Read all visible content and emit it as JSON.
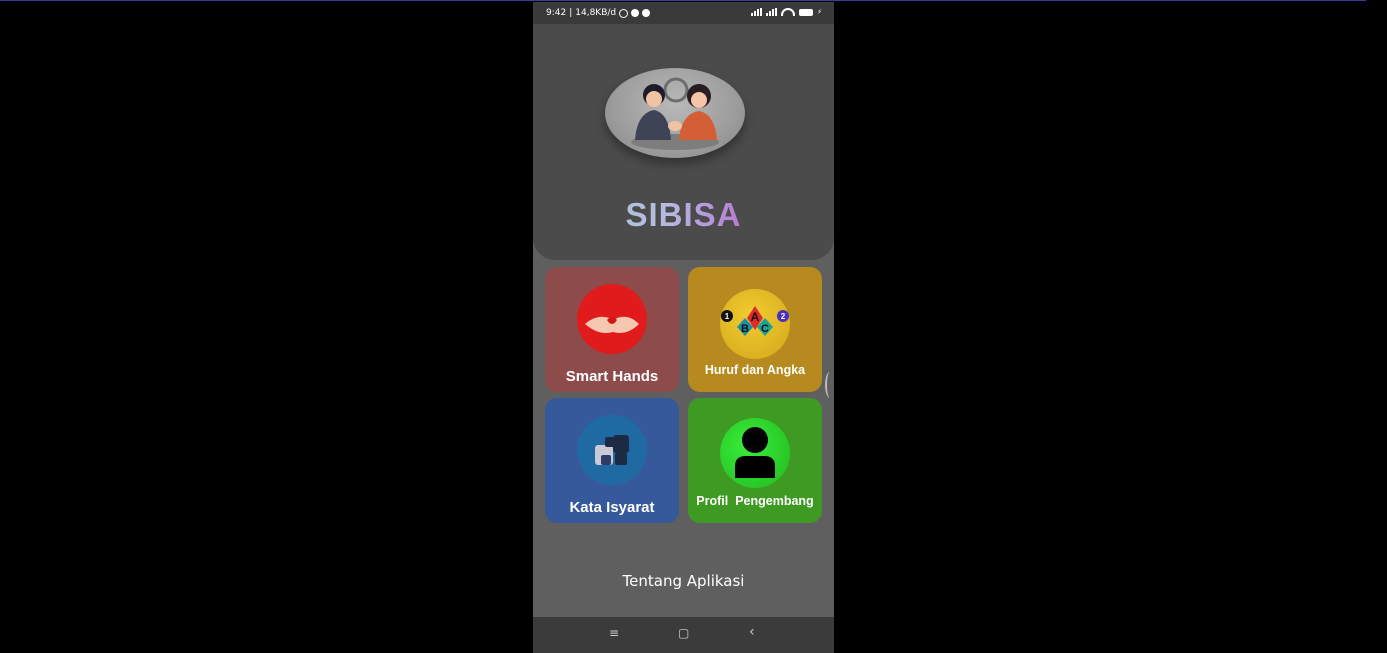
{
  "status_bar": {
    "time": "9:42",
    "separator": "|",
    "network_speed": "14,8KB/d"
  },
  "app": {
    "title": "SIBISA"
  },
  "menu": {
    "items": [
      {
        "label": "Smart Hands",
        "color": "#8e4b4b"
      },
      {
        "label": "Huruf dan Angka",
        "color": "#b78a1f"
      },
      {
        "label": "Kata Isyarat",
        "color": "#35599b"
      },
      {
        "label": "Profil  Pengembang",
        "color": "#3e9a22"
      }
    ]
  },
  "huruf_icon": {
    "letters": [
      "A",
      "B",
      "C"
    ],
    "numbers": [
      "1",
      "2"
    ]
  },
  "footer": {
    "about_label": "Tentang Aplikasi"
  },
  "nav": {
    "menu_glyph": "≡",
    "home_glyph": "▢",
    "back_glyph": "‹"
  }
}
